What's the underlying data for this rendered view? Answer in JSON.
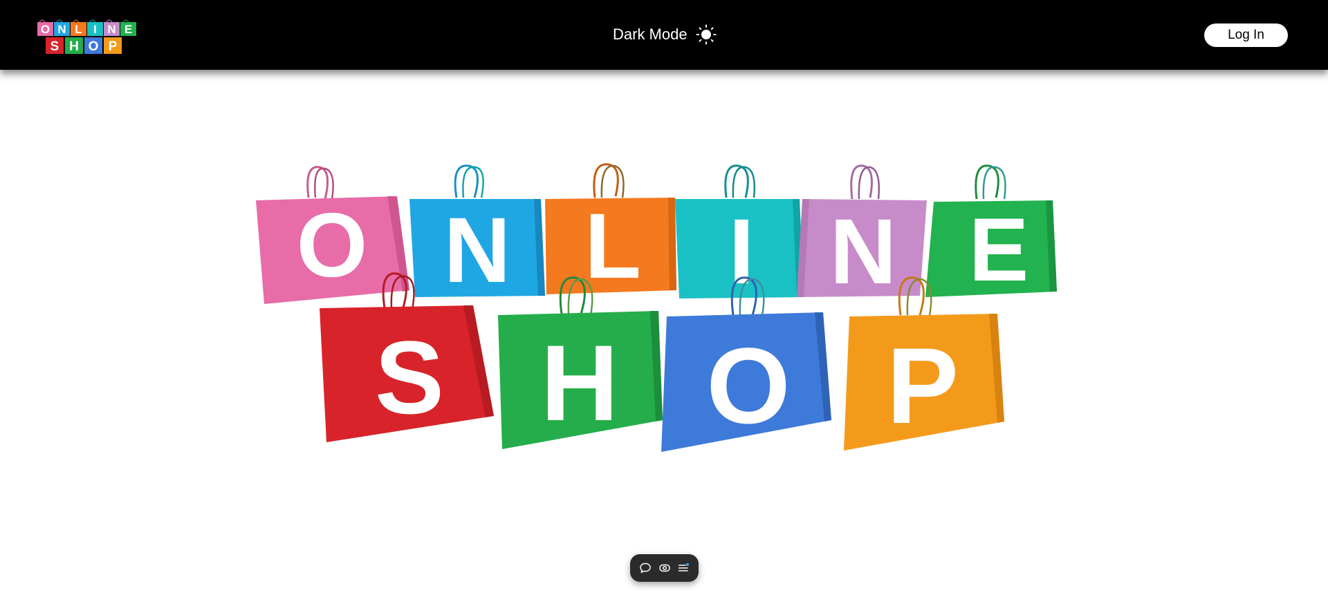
{
  "header": {
    "logo": {
      "top_word": [
        "O",
        "N",
        "L",
        "I",
        "N",
        "E"
      ],
      "bottom_word": [
        "S",
        "H",
        "O",
        "P"
      ],
      "icon": "online-shop-logo"
    },
    "mode_toggle": {
      "label": "Dark Mode",
      "icon": "sun-icon"
    },
    "login_label": "Log In"
  },
  "hero": {
    "icon": "shopping-bags-banner",
    "top_word": [
      "O",
      "N",
      "L",
      "I",
      "N",
      "E"
    ],
    "bottom_word": [
      "S",
      "H",
      "O",
      "P"
    ]
  },
  "floating_toolbar": {
    "items": [
      {
        "icon": "comment-icon"
      },
      {
        "icon": "eye-icon"
      },
      {
        "icon": "menu-list-icon"
      }
    ]
  },
  "colors": {
    "header_bg": "#000000",
    "page_bg": "#ffffff",
    "bag_pink": "#e76ca8",
    "bag_blue": "#1fa7e4",
    "bag_orange": "#f4791f",
    "bag_teal": "#19c1c4",
    "bag_purple": "#c88bc9",
    "bag_green": "#22b24f",
    "bag_red": "#d8232a",
    "bag_green2": "#24ad4a",
    "bag_royal": "#3e7ad9",
    "bag_amber": "#f49a1b"
  }
}
